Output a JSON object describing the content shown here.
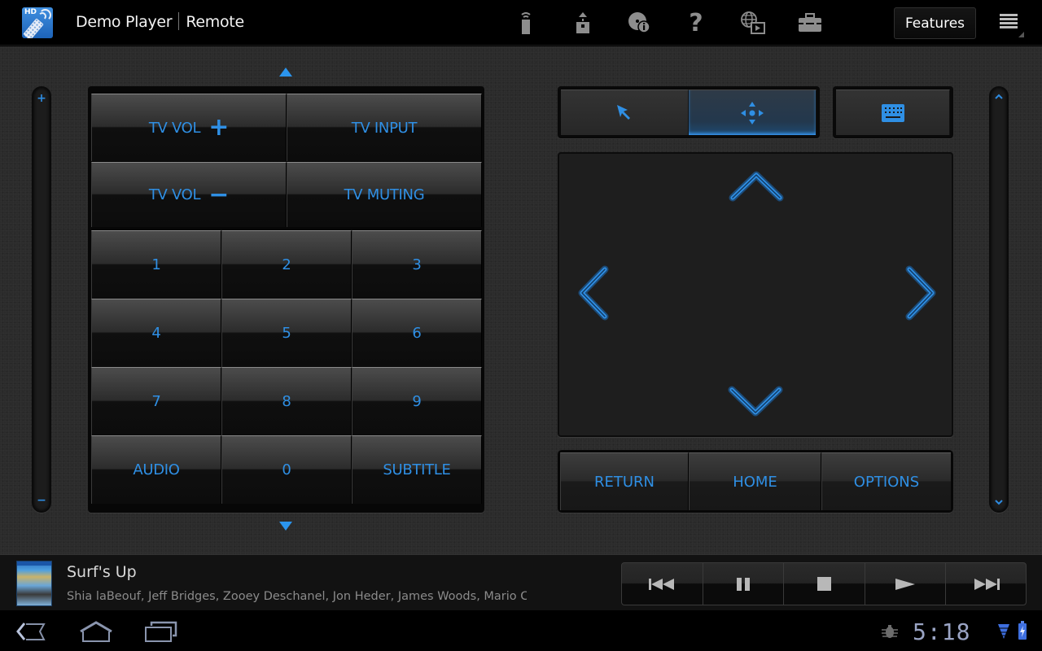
{
  "actionbar": {
    "app_name": "Demo Player",
    "screen_name": "Remote",
    "app_icon_badge": "HD",
    "icons": [
      {
        "name": "remote-signal-icon",
        "label": "Remote"
      },
      {
        "name": "eject-icon",
        "label": "Eject"
      },
      {
        "name": "disc-info-icon",
        "label": "Disc info"
      },
      {
        "name": "help-icon",
        "label": "Help"
      },
      {
        "name": "web-video-icon",
        "label": "Web video"
      },
      {
        "name": "toolbox-icon",
        "label": "Tools"
      }
    ],
    "features_label": "Features",
    "overflow_icon": "overflow-menu-icon"
  },
  "left_slider": {
    "top_glyph": "+",
    "bottom_glyph": "−"
  },
  "right_slider": {
    "top_glyph": "˄",
    "bottom_glyph": "˅"
  },
  "keypad": {
    "scroll_up_icon": "triangle-up-icon",
    "scroll_down_icon": "triangle-down-icon",
    "tv_keys": [
      {
        "label": "TV VOL",
        "symbol": "+"
      },
      {
        "label": "TV INPUT",
        "symbol": ""
      },
      {
        "label": "TV VOL",
        "symbol": "−"
      },
      {
        "label": "TV MUTING",
        "symbol": ""
      }
    ],
    "keys": [
      "1",
      "2",
      "3",
      "4",
      "5",
      "6",
      "7",
      "8",
      "9",
      "AUDIO",
      "0",
      "SUBTITLE"
    ]
  },
  "modes": {
    "items": [
      {
        "name": "pointer-mode",
        "icon": "cursor-arrow-icon",
        "active": false
      },
      {
        "name": "dpad-mode",
        "icon": "dpad-icon",
        "active": true
      }
    ],
    "keyboard": {
      "icon": "keyboard-icon"
    }
  },
  "touchpad": {
    "arrows": [
      "up",
      "left",
      "right",
      "down"
    ]
  },
  "nav_buttons": [
    "RETURN",
    "HOME",
    "OPTIONS"
  ],
  "now_playing": {
    "title": "Surf's Up",
    "cast": "Shia laBeouf, Jeff Bridges, Zooey Deschanel, Jon Heder, James Woods, Mario Ca",
    "transport": [
      {
        "name": "previous-button",
        "icon": "skip-previous-icon"
      },
      {
        "name": "pause-button",
        "icon": "pause-icon"
      },
      {
        "name": "stop-button",
        "icon": "stop-icon"
      },
      {
        "name": "play-button",
        "icon": "play-icon"
      },
      {
        "name": "next-button",
        "icon": "skip-next-icon"
      }
    ]
  },
  "system_bar": {
    "time": "5:18",
    "buttons": [
      "back",
      "home",
      "recent-apps"
    ]
  },
  "colors": {
    "accent": "#2f8fe4",
    "background": "#2b2b2b",
    "bar": "#000000"
  }
}
